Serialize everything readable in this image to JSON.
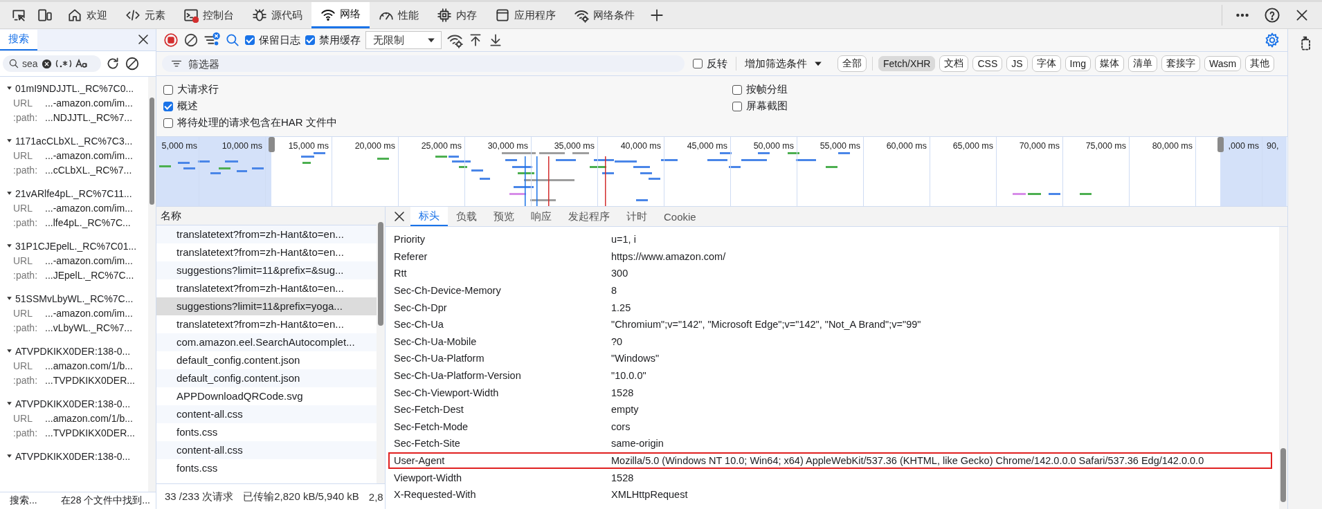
{
  "main_tabs": [
    {
      "label": "欢迎",
      "selected": false
    },
    {
      "label": "元素",
      "selected": false
    },
    {
      "label": "控制台",
      "selected": false
    },
    {
      "label": "源代码",
      "selected": false
    },
    {
      "label": "网络",
      "selected": true
    },
    {
      "label": "性能",
      "selected": false
    },
    {
      "label": "内存",
      "selected": false
    },
    {
      "label": "应用程序",
      "selected": false
    },
    {
      "label": "网络条件",
      "selected": false
    }
  ],
  "search_panel": {
    "tab": "搜索",
    "query": "sea",
    "results": [
      {
        "title": "01mI9NDJJTL._RC%7C0...",
        "url_label": "URL",
        "url": "...-amazon.com/im...",
        "path_label": ":path:",
        "path": "...NDJJTL._RC%7..."
      },
      {
        "title": "1171acCLbXL._RC%7C3...",
        "url_label": "URL",
        "url": "...-amazon.com/im...",
        "path_label": ":path:",
        "path": "...cCLbXL._RC%7..."
      },
      {
        "title": "21vARlfe4pL._RC%7C11...",
        "url_label": "URL",
        "url": "...-amazon.com/im...",
        "path_label": ":path:",
        "path": "...lfe4pL._RC%7C..."
      },
      {
        "title": "31P1CJEpelL._RC%7C01...",
        "url_label": "URL",
        "url": "...-amazon.com/im...",
        "path_label": ":path:",
        "path": "...JEpelL._RC%7C..."
      },
      {
        "title": "51SSMvLbyWL._RC%7C...",
        "url_label": "URL",
        "url": "...-amazon.com/im...",
        "path_label": ":path:",
        "path": "...vLbyWL._RC%7..."
      },
      {
        "title": "ATVPDKIKX0DER:138-0...",
        "url_label": "URL",
        "url": "...amazon.com/1/b...",
        "path_label": ":path:",
        "path": "...TVPDKIKX0DER..."
      },
      {
        "title": "ATVPDKIKX0DER:138-0...",
        "url_label": "URL",
        "url": "...amazon.com/1/b...",
        "path_label": ":path:",
        "path": "...TVPDKIKX0DER..."
      },
      {
        "title": "ATVPDKIKX0DER:138-0..."
      }
    ],
    "status": "搜索...",
    "summary": "在28 个文件中找到..."
  },
  "toolbar": {
    "checkboxes": [
      {
        "label": "保留日志",
        "checked": true
      },
      {
        "label": "禁用缓存",
        "checked": true
      }
    ],
    "throttle": "无限制"
  },
  "filter_bar": {
    "placeholder": "筛选器",
    "invert": {
      "label": "反转",
      "checked": false
    },
    "add_filter": "增加筛选条件",
    "types": [
      {
        "label": "全部",
        "selected": false
      },
      {
        "label": "Fetch/XHR",
        "selected": true
      },
      {
        "label": "文档",
        "selected": false
      },
      {
        "label": "CSS",
        "selected": false
      },
      {
        "label": "JS",
        "selected": false
      },
      {
        "label": "字体",
        "selected": false
      },
      {
        "label": "Img",
        "selected": false
      },
      {
        "label": "媒体",
        "selected": false
      },
      {
        "label": "清单",
        "selected": false
      },
      {
        "label": "套接字",
        "selected": false
      },
      {
        "label": "Wasm",
        "selected": false
      },
      {
        "label": "其他",
        "selected": false
      }
    ]
  },
  "options": [
    {
      "label": "大请求行",
      "checked": false
    },
    {
      "label": "按帧分组",
      "checked": false
    },
    {
      "label": "概述",
      "checked": true
    },
    {
      "label": "屏幕截图",
      "checked": false
    },
    {
      "label": "将待处理的请求包含在HAR 文件中",
      "checked": false
    }
  ],
  "timeline": {
    "ticks": [
      "5,000 ms",
      "10,000 ms",
      "15,000 ms",
      "20,000 ms",
      "25,000 ms",
      "30,000 ms",
      "35,000 ms",
      "40,000 ms",
      "45,000 ms",
      "50,000 ms",
      "55,000 ms",
      "60,000 ms",
      "65,000 ms",
      "70,000 ms",
      "75,000 ms",
      "80,000 ms",
      ",000 ms",
      "90,"
    ]
  },
  "requests": {
    "column": "名称",
    "rows": [
      {
        "name": "translatetext?from=zh-Hant&to=en...",
        "selected": false
      },
      {
        "name": "translatetext?from=zh-Hant&to=en...",
        "selected": false
      },
      {
        "name": "suggestions?limit=11&prefix=&sug...",
        "selected": false
      },
      {
        "name": "translatetext?from=zh-Hant&to=en...",
        "selected": false
      },
      {
        "name": "suggestions?limit=11&prefix=yoga...",
        "selected": true
      },
      {
        "name": "translatetext?from=zh-Hant&to=en...",
        "selected": false
      },
      {
        "name": "com.amazon.eel.SearchAutocomplet...",
        "selected": false
      },
      {
        "name": "default_config.content.json",
        "selected": false
      },
      {
        "name": "default_config.content.json",
        "selected": false
      },
      {
        "name": "APPDownloadQRCode.svg",
        "selected": false
      },
      {
        "name": "content-all.css",
        "selected": false
      },
      {
        "name": "fonts.css",
        "selected": false
      },
      {
        "name": "content-all.css",
        "selected": false
      },
      {
        "name": "fonts.css",
        "selected": false
      }
    ],
    "status": [
      "33 /233 次请求",
      "已传输2,820 kB/5,940 kB",
      "2,8"
    ]
  },
  "details": {
    "tabs": [
      {
        "label": "标头",
        "selected": true
      },
      {
        "label": "负载",
        "selected": false
      },
      {
        "label": "预览",
        "selected": false
      },
      {
        "label": "响应",
        "selected": false
      },
      {
        "label": "发起程序",
        "selected": false
      },
      {
        "label": "计时",
        "selected": false
      },
      {
        "label": "Cookie",
        "selected": false
      }
    ],
    "headers": [
      {
        "name": "Priority",
        "value": "u=1, i",
        "highlighted": false
      },
      {
        "name": "Referer",
        "value": "https://www.amazon.com/",
        "highlighted": false
      },
      {
        "name": "Rtt",
        "value": "300",
        "highlighted": false
      },
      {
        "name": "Sec-Ch-Device-Memory",
        "value": "8",
        "highlighted": false
      },
      {
        "name": "Sec-Ch-Dpr",
        "value": "1.25",
        "highlighted": false
      },
      {
        "name": "Sec-Ch-Ua",
        "value": "\"Chromium\";v=\"142\", \"Microsoft Edge\";v=\"142\", \"Not_A Brand\";v=\"99\"",
        "highlighted": false
      },
      {
        "name": "Sec-Ch-Ua-Mobile",
        "value": "?0",
        "highlighted": false
      },
      {
        "name": "Sec-Ch-Ua-Platform",
        "value": "\"Windows\"",
        "highlighted": false
      },
      {
        "name": "Sec-Ch-Ua-Platform-Version",
        "value": "\"10.0.0\"",
        "highlighted": false
      },
      {
        "name": "Sec-Ch-Viewport-Width",
        "value": "1528",
        "highlighted": false
      },
      {
        "name": "Sec-Fetch-Dest",
        "value": "empty",
        "highlighted": false
      },
      {
        "name": "Sec-Fetch-Mode",
        "value": "cors",
        "highlighted": false
      },
      {
        "name": "Sec-Fetch-Site",
        "value": "same-origin",
        "highlighted": false
      },
      {
        "name": "User-Agent",
        "value": "Mozilla/5.0 (Windows NT 10.0; Win64; x64) AppleWebKit/537.36 (KHTML, like Gecko) Chrome/142.0.0.0 Safari/537.36 Edg/142.0.0.0",
        "highlighted": true
      },
      {
        "name": "Viewport-Width",
        "value": "1528",
        "highlighted": false
      },
      {
        "name": "X-Requested-With",
        "value": "XMLHttpRequest",
        "highlighted": false
      }
    ]
  }
}
